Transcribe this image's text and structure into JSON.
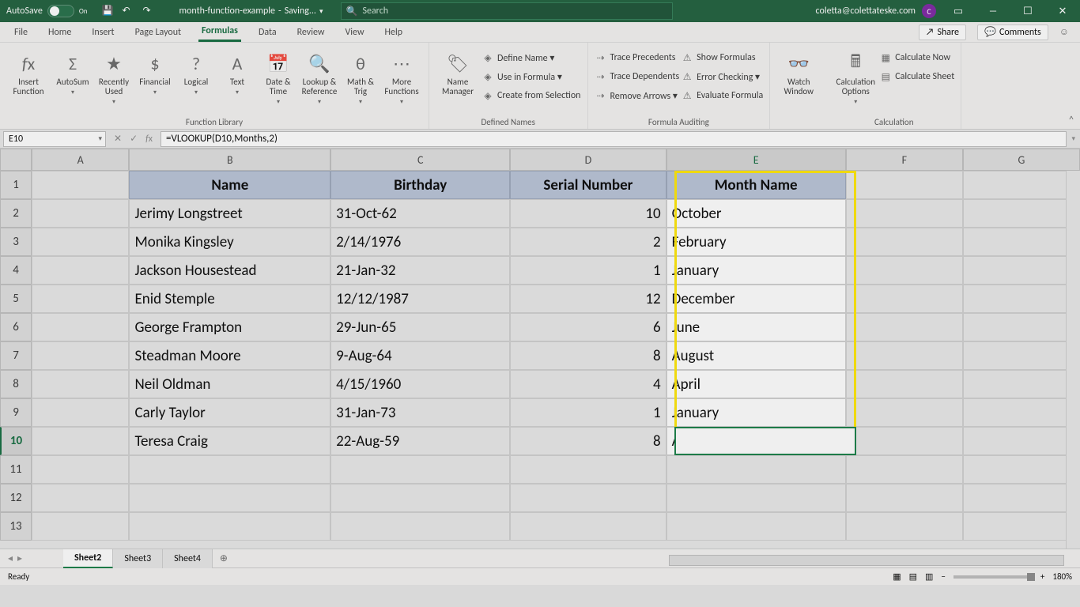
{
  "title": {
    "autosave": "AutoSave",
    "autosave_state": "On",
    "filename": "month-function-example",
    "status": "Saving...",
    "search_placeholder": "Search",
    "user_email": "coletta@colettateske.com",
    "user_initial": "C"
  },
  "menu": {
    "tabs": [
      "File",
      "Home",
      "Insert",
      "Page Layout",
      "Formulas",
      "Data",
      "Review",
      "View",
      "Help"
    ],
    "active": "Formulas",
    "share": "Share",
    "comments": "Comments"
  },
  "ribbon": {
    "insert_function": "Insert\nFunction",
    "library": [
      "AutoSum",
      "Recently\nUsed",
      "Financial",
      "Logical",
      "Text",
      "Date &\nTime",
      "Lookup &\nReference",
      "Math &\nTrig",
      "More\nFunctions"
    ],
    "group_library": "Function Library",
    "name_manager": "Name\nManager",
    "defined_cmds": [
      "Define Name",
      "Use in Formula",
      "Create from Selection"
    ],
    "group_defined": "Defined Names",
    "auditing": [
      "Trace Precedents",
      "Trace Dependents",
      "Remove Arrows"
    ],
    "auditing2": [
      "Show Formulas",
      "Error Checking",
      "Evaluate Formula"
    ],
    "group_auditing": "Formula Auditing",
    "watch": "Watch\nWindow",
    "calc_options": "Calculation\nOptions",
    "calc_now": "Calculate Now",
    "calc_sheet": "Calculate Sheet",
    "group_calc": "Calculation"
  },
  "formulabar": {
    "namebox": "E10",
    "formula": "=VLOOKUP(D10,Months,2)"
  },
  "columns": [
    "A",
    "B",
    "C",
    "D",
    "E",
    "F",
    "G"
  ],
  "rowheaders": [
    "1",
    "2",
    "3",
    "4",
    "5",
    "6",
    "7",
    "8",
    "9",
    "10",
    "11",
    "12",
    "13"
  ],
  "active_row": "10",
  "headers": {
    "name": "Name",
    "birthday": "Birthday",
    "serial": "Serial Number",
    "month": "Month Name"
  },
  "data_rows": [
    {
      "name": "Jerimy Longstreet",
      "birthday": "31-Oct-62",
      "serial": "10",
      "month": "October"
    },
    {
      "name": "Monika Kingsley",
      "birthday": "2/14/1976",
      "serial": "2",
      "month": "February"
    },
    {
      "name": "Jackson Housestead",
      "birthday": "21-Jan-32",
      "serial": "1",
      "month": "January"
    },
    {
      "name": "Enid Stemple",
      "birthday": "12/12/1987",
      "serial": "12",
      "month": "December"
    },
    {
      "name": "George Frampton",
      "birthday": "29-Jun-65",
      "serial": "6",
      "month": "June"
    },
    {
      "name": "Steadman Moore",
      "birthday": "9-Aug-64",
      "serial": "8",
      "month": "August"
    },
    {
      "name": "Neil Oldman",
      "birthday": "4/15/1960",
      "serial": "4",
      "month": "April"
    },
    {
      "name": "Carly Taylor",
      "birthday": "31-Jan-73",
      "serial": "1",
      "month": "January"
    },
    {
      "name": "Teresa Craig",
      "birthday": "22-Aug-59",
      "serial": "8",
      "month": "August"
    }
  ],
  "sheets": [
    "Sheet2",
    "Sheet3",
    "Sheet4"
  ],
  "active_sheet": "Sheet2",
  "status": {
    "ready": "Ready",
    "zoom": "180%"
  }
}
